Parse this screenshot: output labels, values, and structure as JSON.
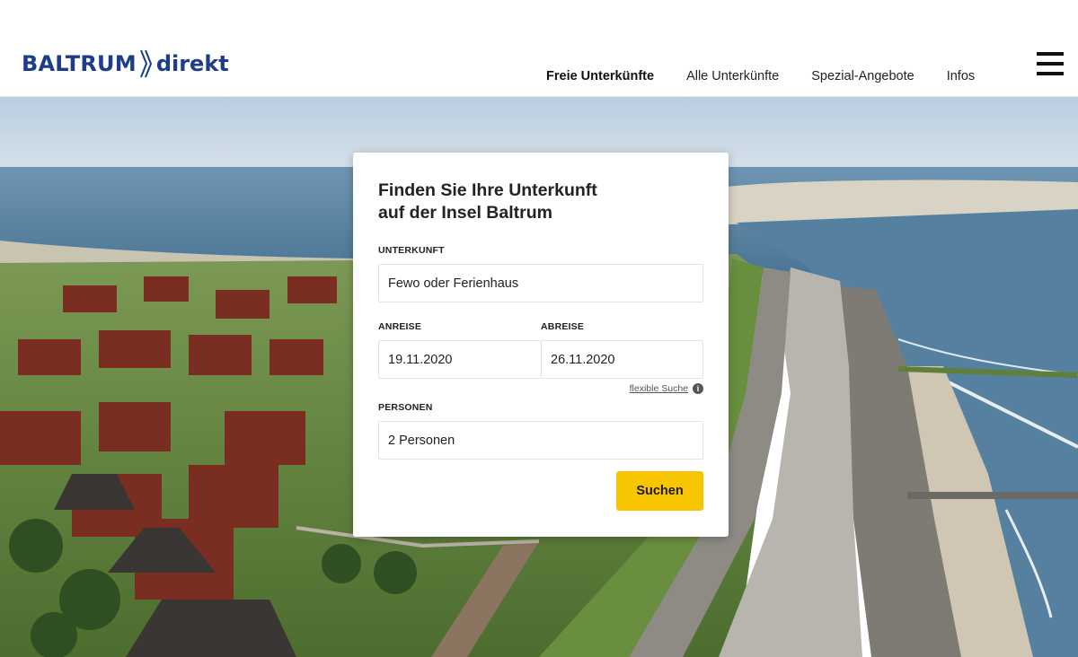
{
  "brand": {
    "name_part1": "BALTRUM",
    "name_part2": "direkt",
    "color": "#1e3c8c",
    "accent": "#f7c600"
  },
  "nav": {
    "items": [
      {
        "label": "Freie Unterkünfte",
        "active": true
      },
      {
        "label": "Alle Unterkünfte",
        "active": false
      },
      {
        "label": "Spezial-Angebote",
        "active": false
      },
      {
        "label": "Infos",
        "active": false
      }
    ],
    "menu_icon": "hamburger-icon"
  },
  "hero": {
    "image": "aerial photo of Baltrum island village, dike and sea"
  },
  "search": {
    "title_line1": "Finden Sie Ihre Unterkunft",
    "title_line2": "auf der Insel Baltrum",
    "accommodation": {
      "label": "UNTERKUNFT",
      "value": "Fewo oder Ferienhaus"
    },
    "arrival": {
      "label": "ANREISE",
      "value": "19.11.2020"
    },
    "departure": {
      "label": "ABREISE",
      "value": "26.11.2020"
    },
    "flexible_link": "flexible Suche",
    "info_icon": "info-icon",
    "persons": {
      "label": "PERSONEN",
      "value": "2 Personen"
    },
    "submit_label": "Suchen"
  }
}
